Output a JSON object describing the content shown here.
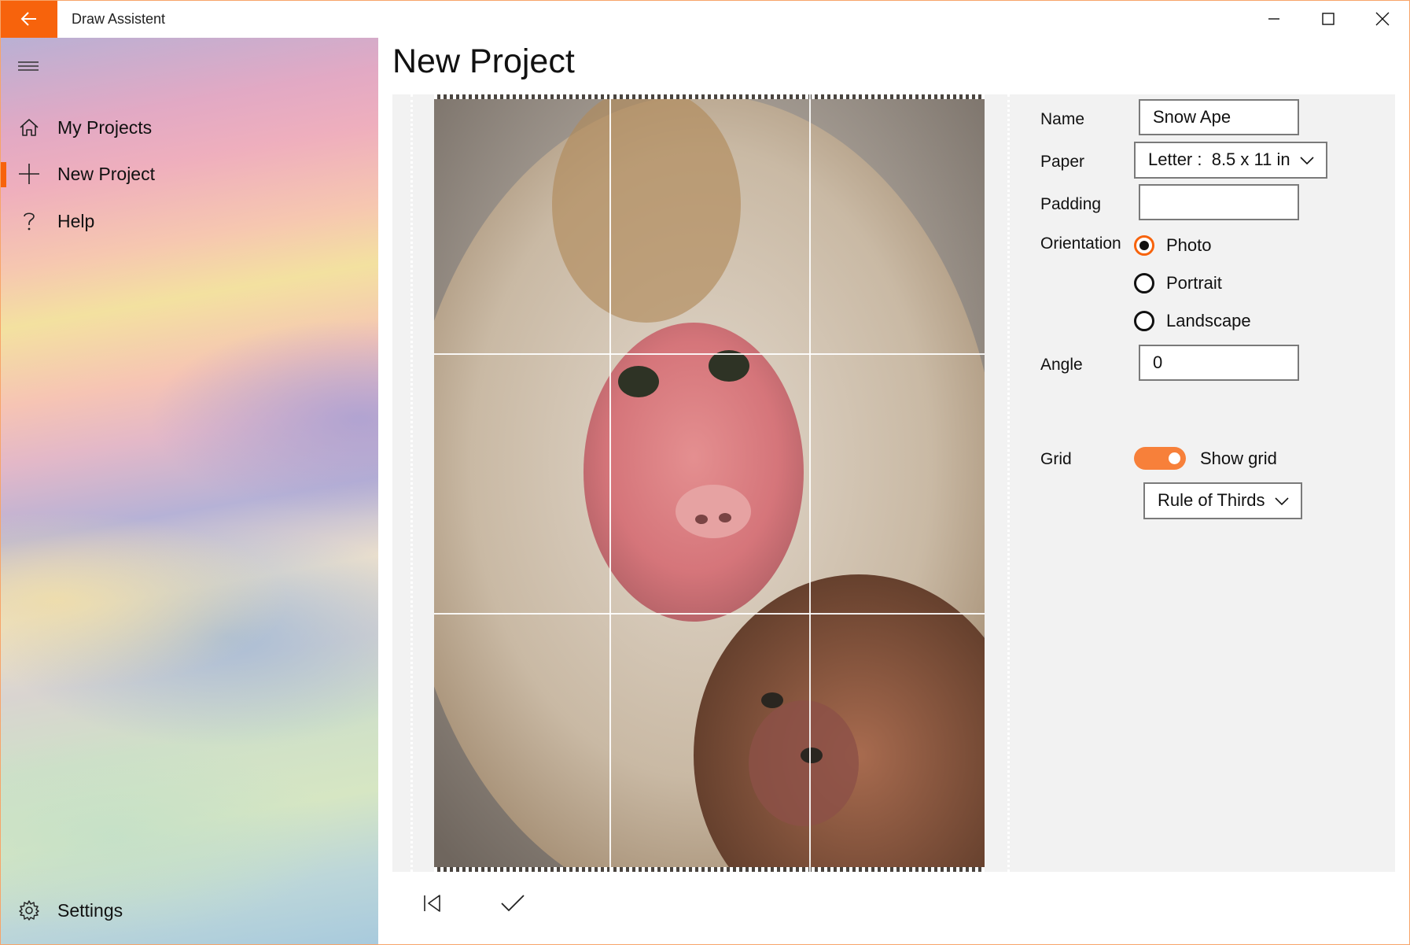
{
  "window": {
    "title": "Draw Assistent"
  },
  "nav": {
    "items": [
      {
        "label": "My Projects",
        "icon": "home-icon"
      },
      {
        "label": "New Project",
        "icon": "add-icon",
        "selected": true
      },
      {
        "label": "Help",
        "icon": "help-icon"
      }
    ],
    "settings_label": "Settings"
  },
  "page": {
    "title": "New Project"
  },
  "form": {
    "name_label": "Name",
    "name_value": "Snow Ape",
    "paper_label": "Paper",
    "paper_value": "Letter :  8.5 x 11 in",
    "padding_label": "Padding",
    "padding_value": "",
    "orientation_label": "Orientation",
    "orientation_options": [
      "Photo",
      "Portrait",
      "Landscape"
    ],
    "orientation_selected": "Photo",
    "angle_label": "Angle",
    "angle_value": "0",
    "grid_label": "Grid",
    "show_grid_label": "Show grid",
    "show_grid_on": true,
    "grid_type_value": "Rule of Thirds"
  },
  "colors": {
    "accent": "#f7630c",
    "toggle_on": "#f7803a",
    "canvas_bg": "#f2f2f2"
  },
  "preview": {
    "image_subject": "snow monkey with baby",
    "grid_type": "rule-of-thirds"
  }
}
